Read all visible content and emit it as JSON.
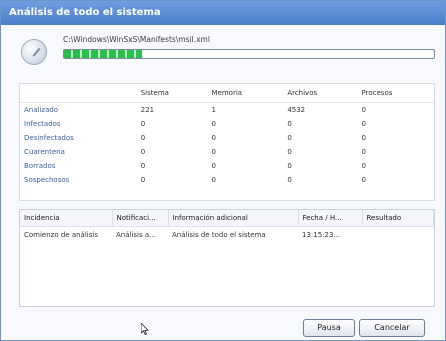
{
  "window": {
    "title": "Análisis de todo el sistema"
  },
  "scan": {
    "path": "C:\\Windows\\WinSxS\\Manifests\\msil.xml",
    "progress": 0.21
  },
  "stats": {
    "headers": [
      "",
      "Sistema",
      "Memoria",
      "Archivos",
      "Procesos"
    ],
    "rows": [
      [
        "Analizado",
        "221",
        "1",
        "4532",
        "0"
      ],
      [
        "Infectados",
        "0",
        "0",
        "0",
        "0"
      ],
      [
        "Desinfectados",
        "0",
        "0",
        "0",
        "0"
      ],
      [
        "Cuarentena",
        "0",
        "0",
        "0",
        "0"
      ],
      [
        "Borrados",
        "0",
        "0",
        "0",
        "0"
      ],
      [
        "Sospechosos",
        "0",
        "0",
        "0",
        "0"
      ]
    ]
  },
  "results": {
    "headers": [
      "Incidencia",
      "Notificaci...",
      "Información adicional",
      "Fecha / H...",
      "Resultado"
    ],
    "rows": [
      [
        "Comienzo de análisis",
        "Análisis a...",
        "Análisis de todo el sistema",
        "13:15:23...",
        ""
      ]
    ]
  },
  "buttons": {
    "pause": "Pausa",
    "cancel": "Cancelar"
  }
}
